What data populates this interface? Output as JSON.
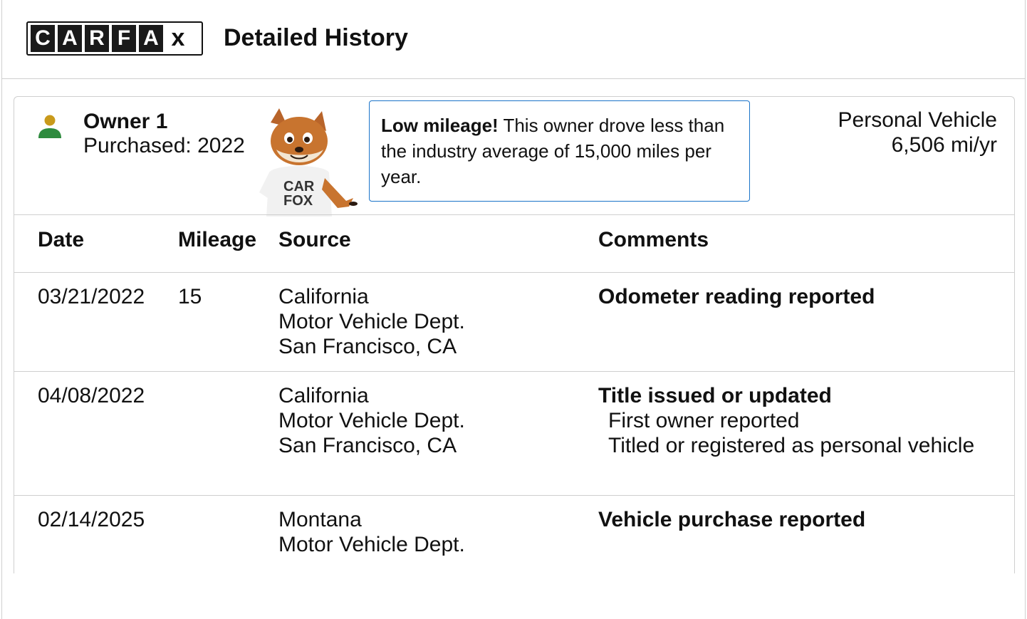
{
  "header": {
    "logo_letters": [
      "C",
      "A",
      "R",
      "F",
      "A",
      "x"
    ],
    "title": "Detailed History"
  },
  "owner": {
    "name": "Owner 1",
    "purchased": "Purchased: 2022",
    "icon": "person-icon",
    "icon_colors": {
      "head": "#c99a1b",
      "body": "#2e8b3e"
    },
    "vehicle_type": "Personal Vehicle",
    "miles_per_year": "6,506 mi/yr"
  },
  "note": {
    "bold": "Low mileage!",
    "text": " This owner drove less than the industry average of 15,000 miles per year.",
    "border_color": "#1a73c9"
  },
  "table": {
    "headers": {
      "date": "Date",
      "mileage": "Mileage",
      "source": "Source",
      "comments": "Comments"
    },
    "rows": [
      {
        "date": "03/21/2022",
        "mileage": "15",
        "source": [
          "California",
          "Motor Vehicle Dept.",
          "San Francisco, CA"
        ],
        "comment_head": "Odometer reading reported",
        "comment_lines": []
      },
      {
        "date": "04/08/2022",
        "mileage": "",
        "source": [
          "California",
          "Motor Vehicle Dept.",
          "San Francisco, CA"
        ],
        "comment_head": "Title issued or updated",
        "comment_lines": [
          "First owner reported",
          "Titled or registered as personal vehicle"
        ]
      },
      {
        "date": "02/14/2025",
        "mileage": "",
        "source": [
          "Montana",
          "Motor Vehicle Dept."
        ],
        "comment_head": "Vehicle purchase reported",
        "comment_lines": []
      }
    ]
  }
}
